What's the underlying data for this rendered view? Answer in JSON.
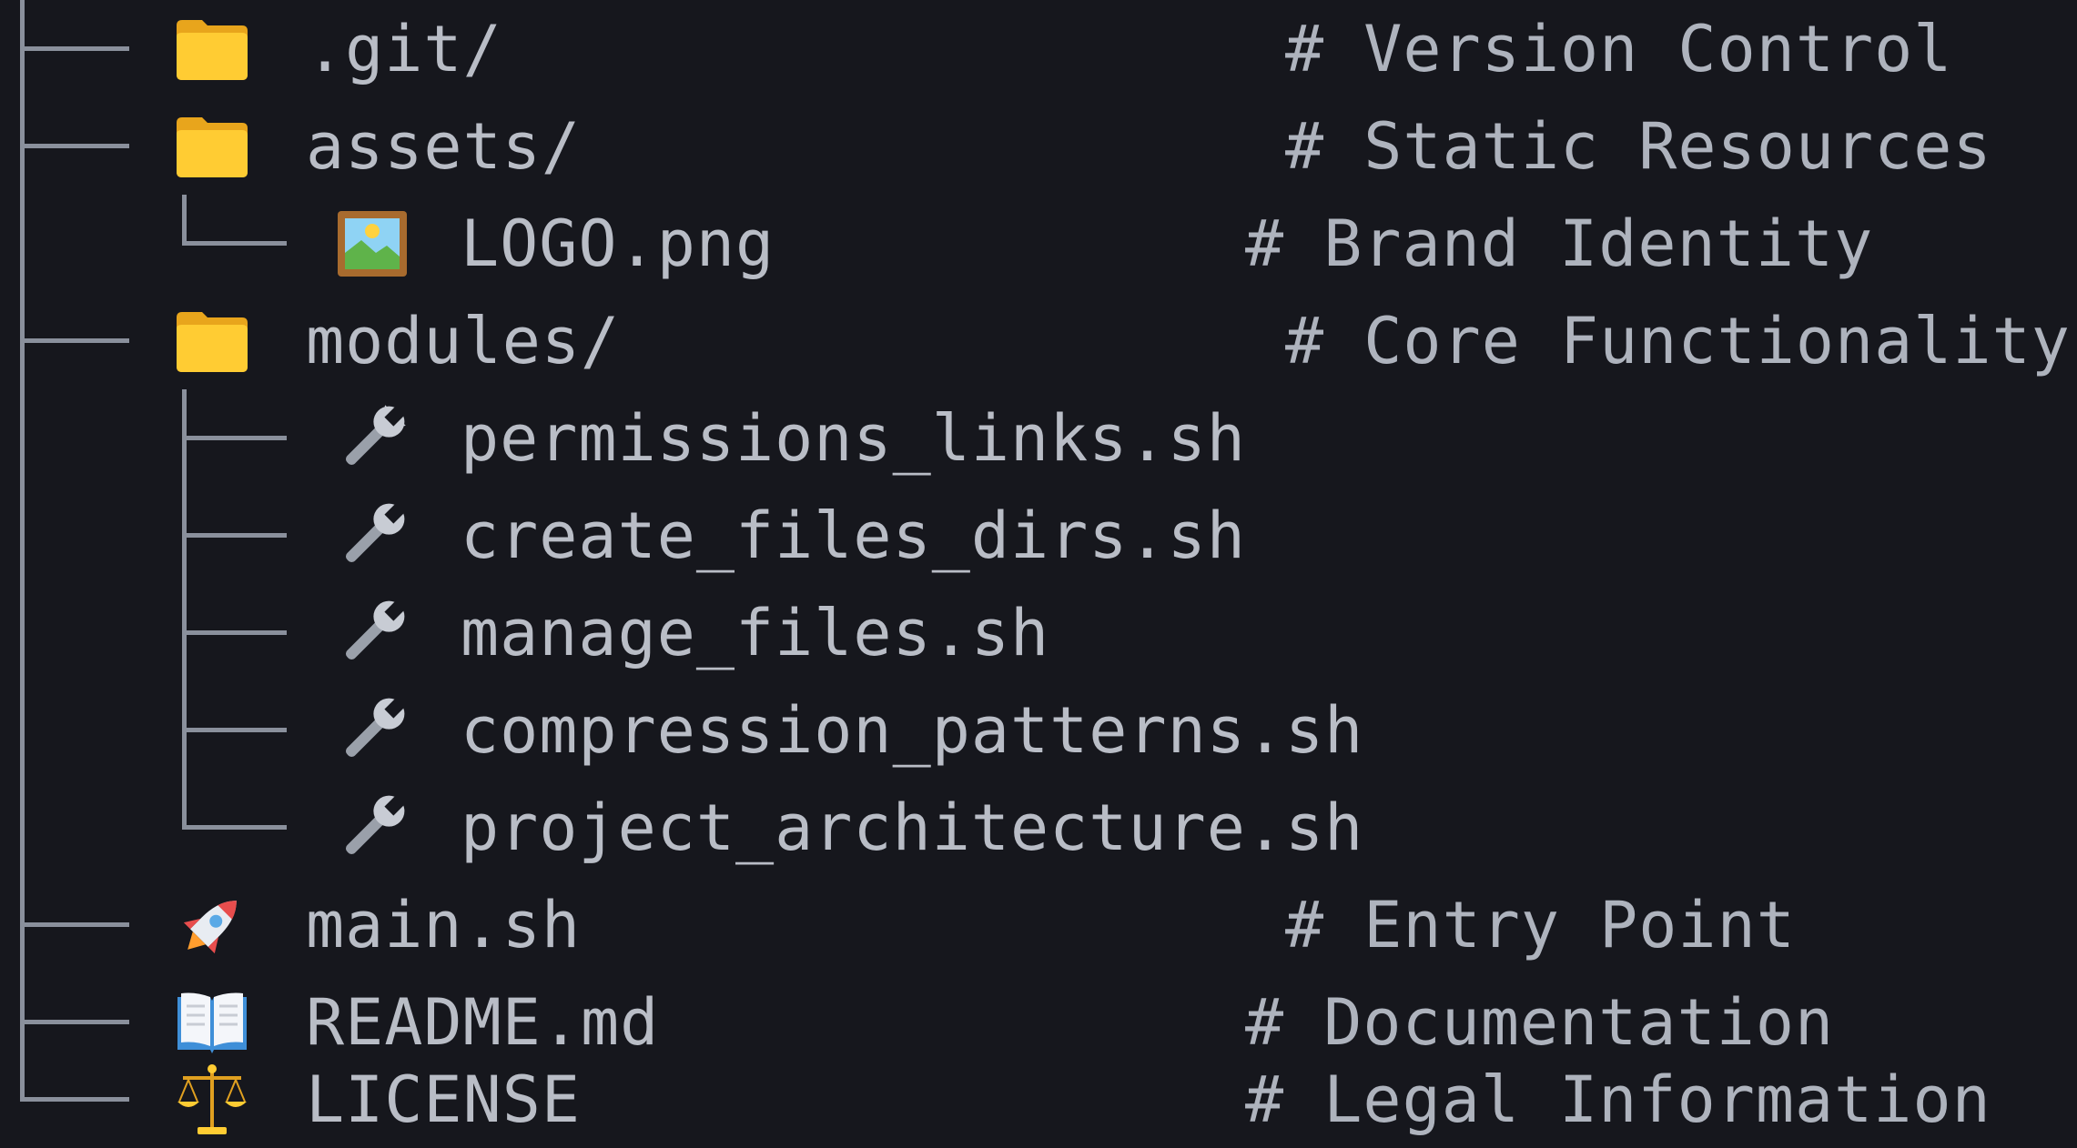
{
  "tree": [
    {
      "name": ".git/",
      "icon": "folder-icon",
      "comment": "# Version Control"
    },
    {
      "name": "assets/",
      "icon": "folder-icon",
      "comment": "# Static Resources"
    },
    {
      "name": "LOGO.png",
      "icon": "image-icon",
      "comment": "# Brand Identity"
    },
    {
      "name": "modules/",
      "icon": "folder-icon",
      "comment": "# Core Functionality"
    },
    {
      "name": "permissions_links.sh",
      "icon": "wrench-icon",
      "comment": ""
    },
    {
      "name": "create_files_dirs.sh",
      "icon": "wrench-icon",
      "comment": ""
    },
    {
      "name": "manage_files.sh",
      "icon": "wrench-icon",
      "comment": ""
    },
    {
      "name": "compression_patterns.sh",
      "icon": "wrench-icon",
      "comment": ""
    },
    {
      "name": "project_architecture.sh",
      "icon": "wrench-icon",
      "comment": ""
    },
    {
      "name": "main.sh",
      "icon": "rocket-icon",
      "comment": "# Entry Point"
    },
    {
      "name": "README.md",
      "icon": "book-icon",
      "comment": "# Documentation"
    },
    {
      "name": "LICENSE",
      "icon": "scales-icon",
      "comment": "# Legal Information"
    }
  ],
  "colors": {
    "background": "#16171d",
    "text": "#b9bdc6",
    "comment": "#aeb3bd",
    "guide": "#8a909c",
    "folder": "#ffcc33"
  }
}
